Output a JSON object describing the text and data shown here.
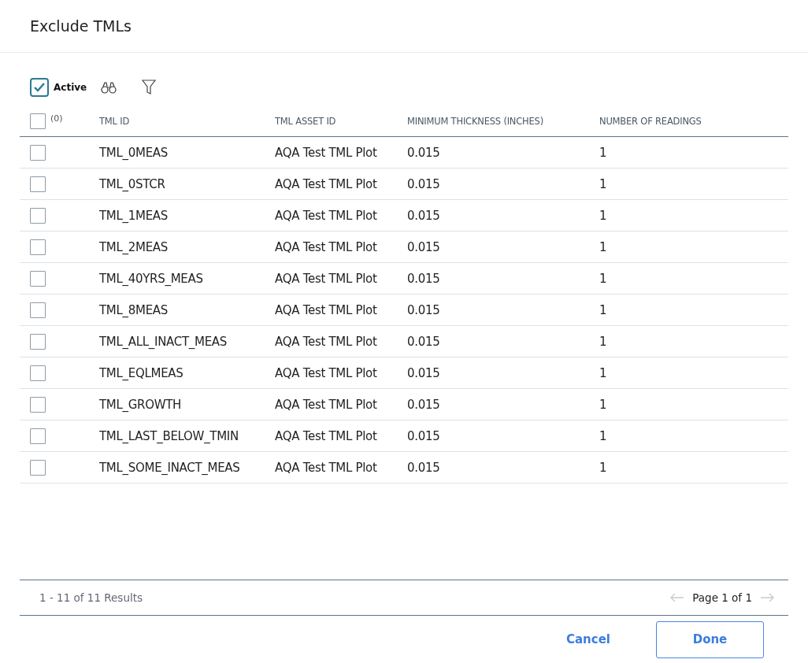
{
  "dialog": {
    "title": "Exclude TMLs"
  },
  "toolbar": {
    "active": {
      "label": "Active",
      "checked": true
    }
  },
  "table": {
    "select_all": {
      "checked": false,
      "count": "(0)"
    },
    "columns": [
      "TML ID",
      "TML ASSET ID",
      "MINIMUM THICKNESS (INCHES)",
      "NUMBER OF READINGS"
    ],
    "rows": [
      {
        "selected": false,
        "cells": [
          "TML_0MEAS",
          "AQA Test TML Plot",
          "0.015",
          "1"
        ]
      },
      {
        "selected": false,
        "cells": [
          "TML_0STCR",
          "AQA Test TML Plot",
          "0.015",
          "1"
        ]
      },
      {
        "selected": false,
        "cells": [
          "TML_1MEAS",
          "AQA Test TML Plot",
          "0.015",
          "1"
        ]
      },
      {
        "selected": false,
        "cells": [
          "TML_2MEAS",
          "AQA Test TML Plot",
          "0.015",
          "1"
        ]
      },
      {
        "selected": false,
        "cells": [
          "TML_40YRS_MEAS",
          "AQA Test TML Plot",
          "0.015",
          "1"
        ]
      },
      {
        "selected": false,
        "cells": [
          "TML_8MEAS",
          "AQA Test TML Plot",
          "0.015",
          "1"
        ]
      },
      {
        "selected": false,
        "cells": [
          "TML_ALL_INACT_MEAS",
          "AQA Test TML Plot",
          "0.015",
          "1"
        ]
      },
      {
        "selected": false,
        "cells": [
          "TML_EQLMEAS",
          "AQA Test TML Plot",
          "0.015",
          "1"
        ]
      },
      {
        "selected": false,
        "cells": [
          "TML_GROWTH",
          "AQA Test TML Plot",
          "0.015",
          "1"
        ]
      },
      {
        "selected": false,
        "cells": [
          "TML_LAST_BELOW_TMIN",
          "AQA Test TML Plot",
          "0.015",
          "1"
        ]
      },
      {
        "selected": false,
        "cells": [
          "TML_SOME_INACT_MEAS",
          "AQA Test TML Plot",
          "0.015",
          "1"
        ]
      }
    ]
  },
  "footer": {
    "results": "1 - 11 of 11 Results",
    "page": "Page 1 of 1",
    "prev_disabled": true,
    "next_disabled": true
  },
  "buttons": [
    {
      "label": "Cancel",
      "kind": "link"
    },
    {
      "label": "Done",
      "kind": "outline"
    }
  ]
}
